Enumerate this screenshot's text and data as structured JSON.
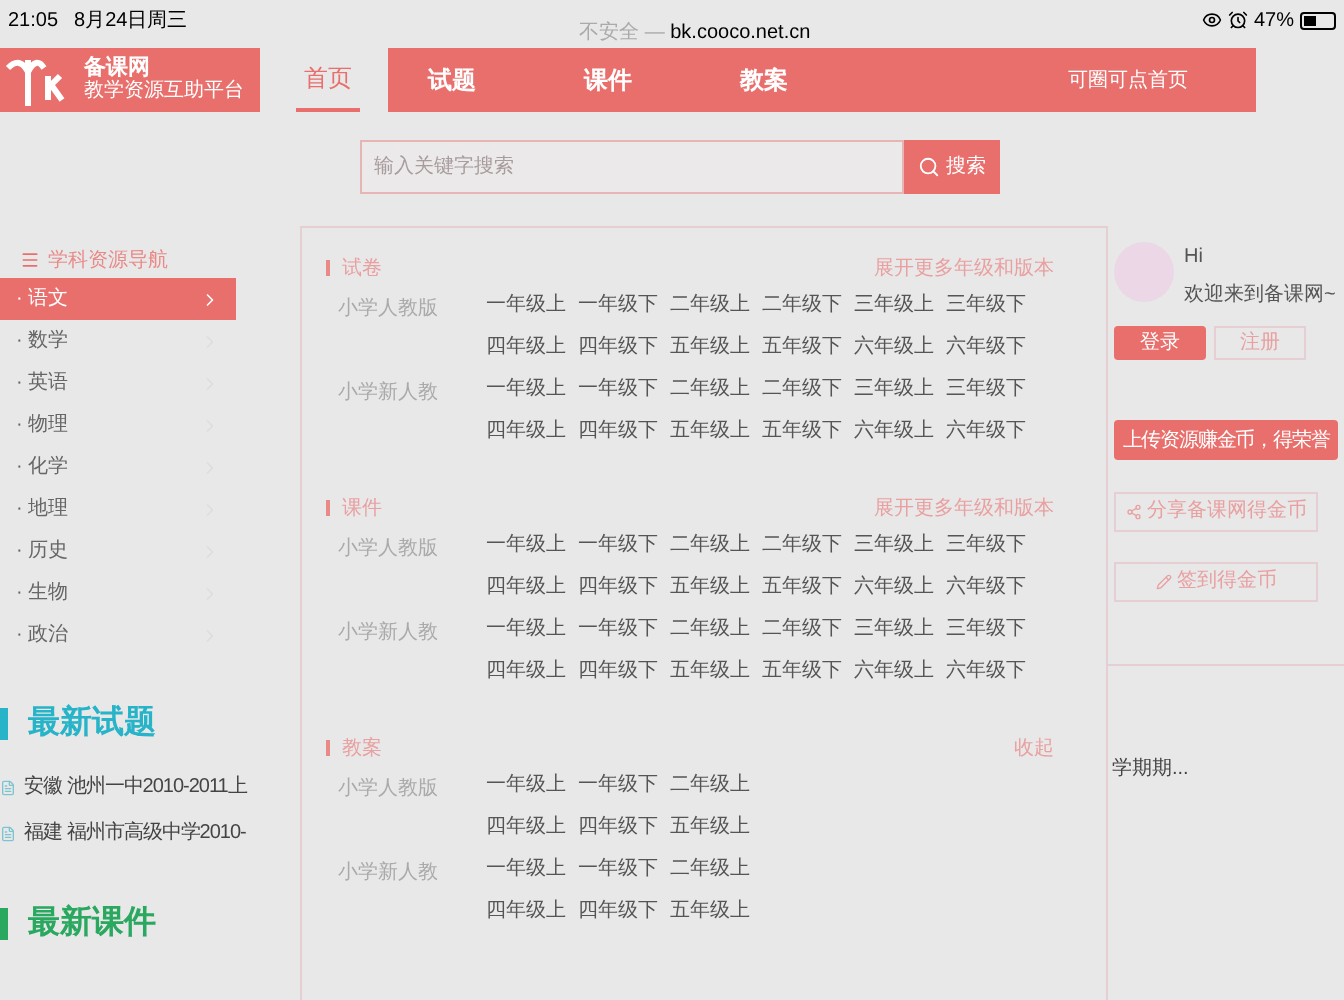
{
  "status_bar": {
    "time": "21:05",
    "date": "8月24日周三",
    "url_prefix": "不安全 —",
    "url": "bk.cooco.net.cn",
    "battery": "47%"
  },
  "header": {
    "logo_title": "备课网",
    "logo_subtitle": "教学资源互助平台",
    "nav": [
      {
        "label": "首页",
        "selected": true
      },
      {
        "label": "试题",
        "selected": false
      },
      {
        "label": "课件",
        "selected": false
      },
      {
        "label": "教案",
        "selected": false
      }
    ],
    "right_link": "可圈可点首页"
  },
  "search": {
    "placeholder": "输入关键字搜索",
    "button": "搜索"
  },
  "sidebar": {
    "title": "学科资源导航",
    "items": [
      {
        "label": "· 语文",
        "selected": true
      },
      {
        "label": "· 数学",
        "selected": false
      },
      {
        "label": "· 英语",
        "selected": false
      },
      {
        "label": "· 物理",
        "selected": false
      },
      {
        "label": "· 化学",
        "selected": false
      },
      {
        "label": "· 地理",
        "selected": false
      },
      {
        "label": "· 历史",
        "selected": false
      },
      {
        "label": "· 生物",
        "selected": false
      },
      {
        "label": "· 政治",
        "selected": false
      }
    ]
  },
  "latest_exams": {
    "title": "最新试题",
    "items": [
      "安徽 池州一中2010-2011上",
      "福建 福州市高级中学2010-"
    ]
  },
  "latest_courseware": {
    "title": "最新课件"
  },
  "sections": [
    {
      "title": "试卷",
      "action": "展开更多年级和版本",
      "rows": [
        {
          "label": "小学人教版",
          "cells": [
            "一年级上",
            "一年级下",
            "二年级上",
            "二年级下",
            "三年级上",
            "三年级下"
          ]
        },
        {
          "cells": [
            "四年级上",
            "四年级下",
            "五年级上",
            "五年级下",
            "六年级上",
            "六年级下"
          ]
        },
        {
          "label": "小学新人教",
          "cells": [
            "一年级上",
            "一年级下",
            "二年级上",
            "二年级下",
            "三年级上",
            "三年级下"
          ]
        },
        {
          "cells": [
            "四年级上",
            "四年级下",
            "五年级上",
            "五年级下",
            "六年级上",
            "六年级下"
          ]
        }
      ]
    },
    {
      "title": "课件",
      "action": "展开更多年级和版本",
      "rows": [
        {
          "label": "小学人教版",
          "cells": [
            "一年级上",
            "一年级下",
            "二年级上",
            "二年级下",
            "三年级上",
            "三年级下"
          ]
        },
        {
          "cells": [
            "四年级上",
            "四年级下",
            "五年级上",
            "五年级下",
            "六年级上",
            "六年级下"
          ]
        },
        {
          "label": "小学新人教",
          "cells": [
            "一年级上",
            "一年级下",
            "二年级上",
            "二年级下",
            "三年级上",
            "三年级下"
          ]
        },
        {
          "cells": [
            "四年级上",
            "四年级下",
            "五年级上",
            "五年级下",
            "六年级上",
            "六年级下"
          ]
        }
      ]
    },
    {
      "title": "教案",
      "action": "收起",
      "rows": [
        {
          "label": "小学人教版",
          "cells": [
            "一年级上",
            "一年级下",
            "二年级上"
          ]
        },
        {
          "cells": [
            "四年级上",
            "四年级下",
            "五年级上"
          ]
        },
        {
          "label": "小学新人教",
          "cells": [
            "一年级上",
            "一年级下",
            "二年级上"
          ]
        },
        {
          "cells": [
            "四年级上",
            "四年级下",
            "五年级上"
          ]
        }
      ]
    }
  ],
  "user_panel": {
    "greeting": "Hi",
    "welcome": "欢迎来到备课网~",
    "login": "登录",
    "register": "注册",
    "upload": "上传资源赚金币，得荣誉",
    "share": "分享备课网得金币",
    "checkin": "签到得金币",
    "note": "学期期..."
  }
}
